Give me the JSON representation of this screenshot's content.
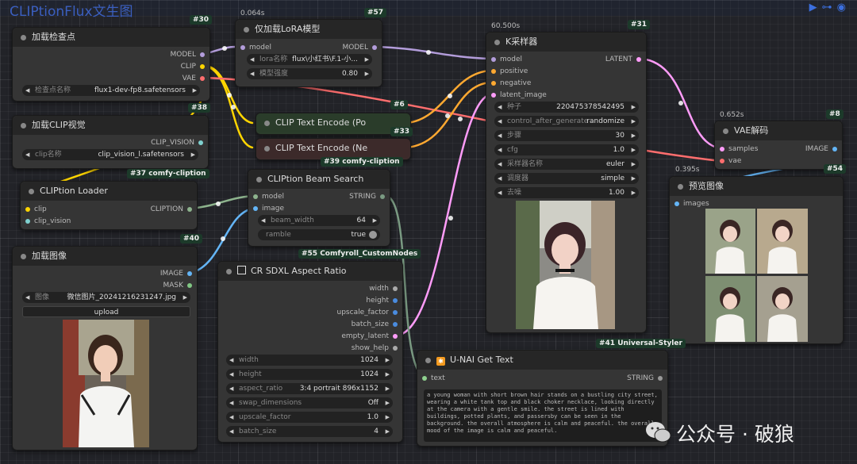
{
  "app": {
    "title": "CLIPtionFlux文生图"
  },
  "toolbar_icons": [
    "play-icon",
    "share-icon",
    "eye-icon"
  ],
  "colors": {
    "clip_wire": "#ffd500",
    "model_wire": "#b39ddb",
    "vae_wire": "#ff6e6e",
    "image_wire": "#64b5f6",
    "latent_wire": "#ff9cf9",
    "conditioning_wire": "#ffa931",
    "string_wire": "#7a9a82"
  },
  "nodes": {
    "checkpoint": {
      "id": "#30",
      "title": "加载检查点",
      "outputs": [
        "MODEL",
        "CLIP",
        "VAE"
      ],
      "widget": {
        "label": "检查点名称",
        "value": "flux1-dev-fp8.safetensors"
      }
    },
    "lora": {
      "id": "#57",
      "time": "0.064s",
      "title": "仅加载LoRA模型",
      "input": "model",
      "output": "MODEL",
      "widgets": [
        {
          "label": "lora名称",
          "value": "flux\\小红书\\F.1-小..."
        },
        {
          "label": "模型强度",
          "value": "0.80"
        }
      ]
    },
    "clip_vision": {
      "id": "#38",
      "title": "加载CLIP视觉",
      "output": "CLIP_VISION",
      "widget": {
        "label": "clip名称",
        "value": "clip_vision_l.safetensors"
      }
    },
    "clip_pos": {
      "id": "#6",
      "title": "CLIP Text Encode (Po"
    },
    "clip_neg": {
      "id": "#33",
      "title": "CLIP Text Encode (Ne"
    },
    "cliption_loader": {
      "id": "#37 comfy-cliption",
      "title": "CLIPtion Loader",
      "inputs": [
        "clip",
        "clip_vision"
      ],
      "output": "CLIPTION"
    },
    "beam": {
      "id": "#39 comfy-cliption",
      "title": "CLIPtion Beam Search",
      "inputs": [
        "model",
        "image"
      ],
      "output": "STRING",
      "widgets": [
        {
          "label": "beam_width",
          "value": "64"
        },
        {
          "label": "ramble",
          "value": "true"
        }
      ]
    },
    "load_image": {
      "id": "#40",
      "title": "加载图像",
      "outputs": [
        "IMAGE",
        "MASK"
      ],
      "widget": {
        "label": "图像",
        "value": "微信图片_20241216231247.jpg"
      },
      "upload": "upload"
    },
    "aspect": {
      "id": "#55 Comfyroll_CustomNodes",
      "title": "CR SDXL Aspect Ratio",
      "outputs": [
        "width",
        "height",
        "upscale_factor",
        "batch_size",
        "empty_latent",
        "show_help"
      ],
      "widgets": [
        {
          "label": "width",
          "value": "1024"
        },
        {
          "label": "height",
          "value": "1024"
        },
        {
          "label": "aspect_ratio",
          "value": "3:4 portrait 896x1152"
        },
        {
          "label": "swap_dimensions",
          "value": "Off"
        },
        {
          "label": "upscale_factor",
          "value": "1.0"
        },
        {
          "label": "batch_size",
          "value": "4"
        }
      ]
    },
    "ksampler": {
      "id": "#31",
      "time": "60.500s",
      "title": "K采样器",
      "inputs": [
        "model",
        "positive",
        "negative",
        "latent_image"
      ],
      "output": "LATENT",
      "widgets": [
        {
          "label": "种子",
          "value": "220475378542495"
        },
        {
          "label": "control_after_generate",
          "value": "randomize"
        },
        {
          "label": "步骤",
          "value": "30"
        },
        {
          "label": "cfg",
          "value": "1.0"
        },
        {
          "label": "采样器名称",
          "value": "euler"
        },
        {
          "label": "调度器",
          "value": "simple"
        },
        {
          "label": "去噪",
          "value": "1.00"
        }
      ]
    },
    "vae_decode": {
      "id": "#8",
      "time": "0.652s",
      "title": "VAE解码",
      "inputs": [
        "samples",
        "vae"
      ],
      "output": "IMAGE"
    },
    "preview": {
      "id": "#54",
      "time": "0.395s",
      "title": "预览图像",
      "input": "images"
    },
    "get_text": {
      "id": "#41 Universal-Styler",
      "title": "U-NAI Get Text",
      "input": "text",
      "output": "STRING",
      "text": "a young woman with short brown hair stands on a bustling city street, wearing a white tank top and black choker necklace, looking directly at the camera with a gentle smile. the street is lined with buildings, potted plants, and passersby can be seen in the background. the overall atmosphere is calm and peaceful. the overall mood of the image is calm and peaceful."
    }
  },
  "watermark": "公众号 · 破狼"
}
